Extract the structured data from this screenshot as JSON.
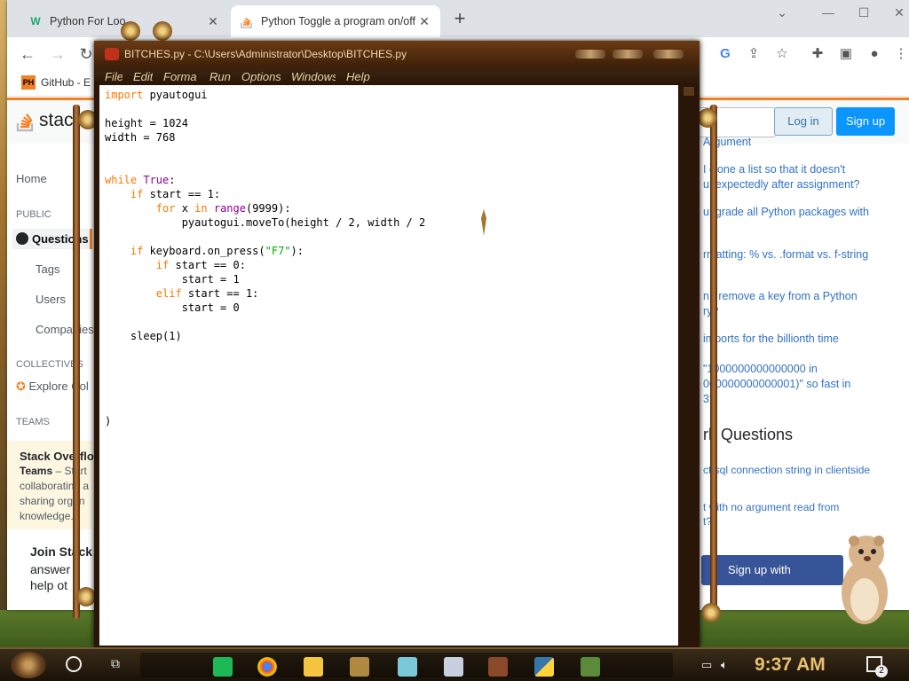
{
  "browser": {
    "tabs": [
      {
        "label": "Python For Loo",
        "favicon": "W",
        "favicon_color": "#1aab6f"
      },
      {
        "label": "Python Toggle a program on/off",
        "favicon": "stackoverflow-icon"
      }
    ],
    "close_glyph": "✕",
    "new_tab_glyph": "+",
    "bookmark": {
      "favicon": "PH",
      "label": "GitHub - E"
    }
  },
  "stackoverflow": {
    "logo_text": "stack ov",
    "login_label": "Log in",
    "signup_label": "Sign up",
    "left_nav": {
      "home": "Home",
      "public_heading": "PUBLIC",
      "questions": "Questions",
      "tags": "Tags",
      "users": "Users",
      "companies": "Companies",
      "collectives_heading": "COLLECTIVES",
      "explore": "Explore Col",
      "teams_heading": "TEAMS",
      "teams_title": "Stack Overflo",
      "teams_subtitle": "Teams",
      "teams_desc_1": " – Start",
      "teams_desc_2": "collaborating a",
      "teams_desc_3": "sharing organ",
      "teams_desc_4": "knowledge.",
      "join_title": "Join Stack",
      "join_line_1": "answer t",
      "join_line_2": "help ot"
    },
    "right_links": [
      "Argument",
      "I clone a list so that it doesn't",
      "unexpectedly after assignment?",
      "upgrade all Python packages with",
      "rmatting: % vs. .format vs. f-string",
      "n I remove a key from a Python",
      "ry?",
      "imports for the billionth time",
      "\"1000000000000000 in",
      "000000000000001)\" so fast in",
      "3?",
      "rk Questions",
      "ct sql connection string in clientside",
      "t with no argument read from",
      "t?"
    ],
    "facebook_label": "Sign up with Facebook"
  },
  "idle": {
    "title": "BITCHES.py - C:\\Users\\Administrator\\Desktop\\BITCHES.py",
    "menu": [
      "File",
      "Edit",
      "Format",
      "Run",
      "Options",
      "Windows",
      "Help"
    ],
    "code": {
      "l1_kw": "import",
      "l1_rest": " pyautogui",
      "l2": "height = 1024",
      "l3": "width = 768",
      "l4_kw": "while",
      "l4_bi": " True",
      "l4_rest": ":",
      "l5_pre": "    ",
      "l5_kw": "if",
      "l5_rest": " start == 1:",
      "l6_pre": "        ",
      "l6_kw": "for",
      "l6_mid": " x ",
      "l6_kw2": "in",
      "l6_bi": " range",
      "l6_rest": "(9999):",
      "l7": "            pyautogui.moveTo(height / 2, width / 2",
      "l8_pre": "    ",
      "l8_kw": "if",
      "l8_rest1": " keyboard.on_press(",
      "l8_str": "\"F7\"",
      "l8_rest2": "):",
      "l9_pre": "        ",
      "l9_kw": "if",
      "l9_rest": " start == 0:",
      "l10": "            start = 1",
      "l11_pre": "        ",
      "l11_kw": "elif",
      "l11_rest": " start == 1:",
      "l12": "            start = 0",
      "l13": "    sleep(1)",
      "l14": ")"
    }
  },
  "taskbar": {
    "time": "9:37 AM",
    "notification_count": "2",
    "icons": [
      "start-gear",
      "search",
      "task-view",
      "spotify",
      "chrome",
      "file-explorer",
      "minecraft-alt",
      "notes",
      "mail",
      "game",
      "python",
      "minecraft"
    ]
  },
  "colors": {
    "so_orange": "#f48024",
    "so_blue": "#0a95ff",
    "link_blue": "#3172c6",
    "idle_keyword": "#ff7700",
    "idle_builtin": "#900090",
    "idle_string": "#00aa00",
    "clock": "#e8c070"
  }
}
